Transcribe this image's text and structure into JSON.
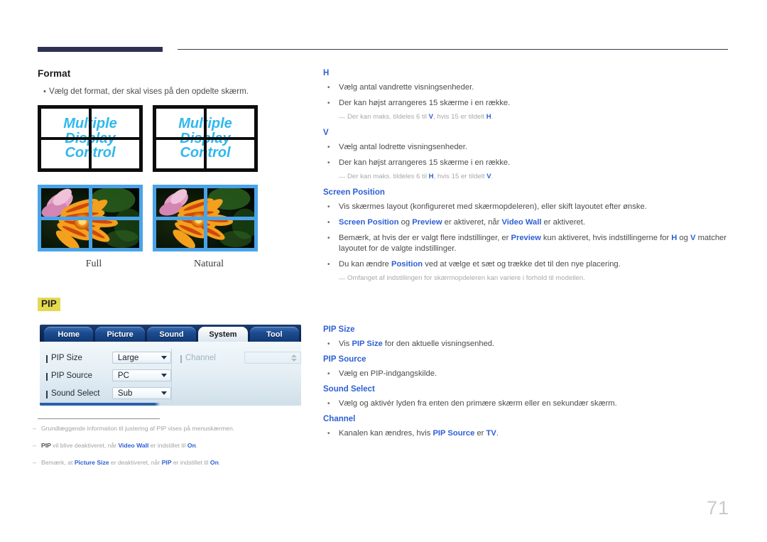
{
  "page": {
    "number": "71"
  },
  "left": {
    "format": {
      "title": "Format",
      "bullet": "Vælg det format, der skal vises på den opdelte skærm."
    },
    "wall_text": {
      "line1": "Multiple",
      "line2": "Display",
      "line3": "Control"
    },
    "captions": {
      "full": "Full",
      "natural": "Natural"
    },
    "pip_badge": "PIP",
    "osd": {
      "tabs": [
        {
          "label": "Home",
          "active": false
        },
        {
          "label": "Picture",
          "active": false
        },
        {
          "label": "Sound",
          "active": false
        },
        {
          "label": "System",
          "active": true
        },
        {
          "label": "Tool",
          "active": false
        }
      ],
      "rows": [
        {
          "label": "PIP Size",
          "value": "Large"
        },
        {
          "label": "PIP Source",
          "value": "PC"
        },
        {
          "label": "Sound Select",
          "value": "Sub"
        }
      ],
      "channel": {
        "label": "Channel",
        "value": ""
      }
    },
    "footnotes": [
      {
        "dash": "–",
        "parts": [
          {
            "t": "Grundlæggende information til justering af  PIP vises på menuskærmen.",
            "s": "plain"
          }
        ]
      },
      {
        "dash": "–",
        "parts": [
          {
            "t": "PIP",
            "s": "bold"
          },
          {
            "t": " vil blive deaktiveret, når ",
            "s": "plain"
          },
          {
            "t": "Video Wall",
            "s": "link"
          },
          {
            "t": " er indstillet til ",
            "s": "plain"
          },
          {
            "t": "On",
            "s": "link"
          },
          {
            "t": ".",
            "s": "plain"
          }
        ]
      },
      {
        "dash": "–",
        "parts": [
          {
            "t": "Bemærk, at ",
            "s": "plain"
          },
          {
            "t": "Picture Size",
            "s": "link"
          },
          {
            "t": " er deaktiveret, når ",
            "s": "plain"
          },
          {
            "t": "PIP",
            "s": "link"
          },
          {
            "t": " er indstillet til ",
            "s": "plain"
          },
          {
            "t": "On",
            "s": "link"
          },
          {
            "t": ".",
            "s": "plain"
          }
        ]
      }
    ]
  },
  "right": {
    "sections": [
      {
        "title": "H",
        "bullets": [
          {
            "parts": [
              {
                "t": "Vælg antal vandrette visningsenheder.",
                "s": "plain"
              }
            ]
          },
          {
            "parts": [
              {
                "t": "Der kan højst arrangeres 15 skærme i en række.",
                "s": "plain"
              }
            ]
          }
        ],
        "notes": [
          {
            "dash": "—",
            "parts": [
              {
                "t": "Der kan maks. tildeles 6 til ",
                "s": "plain"
              },
              {
                "t": "V",
                "s": "link"
              },
              {
                "t": ", hvis 15 er tildelt ",
                "s": "plain"
              },
              {
                "t": "H",
                "s": "link"
              },
              {
                "t": ".",
                "s": "plain"
              }
            ]
          }
        ]
      },
      {
        "title": "V",
        "bullets": [
          {
            "parts": [
              {
                "t": "Vælg antal lodrette visningsenheder.",
                "s": "plain"
              }
            ]
          },
          {
            "parts": [
              {
                "t": "Der kan højst arrangeres 15 skærme i en række.",
                "s": "plain"
              }
            ]
          }
        ],
        "notes": [
          {
            "dash": "—",
            "parts": [
              {
                "t": "Der kan maks. tildeles 6 til ",
                "s": "plain"
              },
              {
                "t": "H",
                "s": "link"
              },
              {
                "t": ", hvis 15 er tildelt ",
                "s": "plain"
              },
              {
                "t": "V",
                "s": "link"
              },
              {
                "t": ".",
                "s": "plain"
              }
            ]
          }
        ]
      },
      {
        "title": "Screen Position",
        "bullets": [
          {
            "parts": [
              {
                "t": "Vis skærmes layout (konfigureret med skærmopdeleren), eller skift layoutet efter ønske.",
                "s": "plain"
              }
            ]
          },
          {
            "parts": [
              {
                "t": "Screen Position",
                "s": "link"
              },
              {
                "t": " og ",
                "s": "plain"
              },
              {
                "t": "Preview",
                "s": "link"
              },
              {
                "t": " er aktiveret, når ",
                "s": "plain"
              },
              {
                "t": "Video Wall",
                "s": "link"
              },
              {
                "t": " er aktiveret.",
                "s": "plain"
              }
            ]
          },
          {
            "parts": [
              {
                "t": "Bemærk, at hvis der er valgt flere indstillinger, er ",
                "s": "plain"
              },
              {
                "t": "Preview",
                "s": "link"
              },
              {
                "t": " kun aktiveret, hvis indstillingerne for ",
                "s": "plain"
              },
              {
                "t": "H",
                "s": "link"
              },
              {
                "t": " og ",
                "s": "plain"
              },
              {
                "t": "V",
                "s": "link"
              },
              {
                "t": " matcher layoutet for de valgte indstillinger.",
                "s": "plain"
              }
            ]
          },
          {
            "parts": [
              {
                "t": "Du kan ændre ",
                "s": "plain"
              },
              {
                "t": "Position",
                "s": "link"
              },
              {
                "t": " ved at vælge et sæt og trække det til den nye placering.",
                "s": "plain"
              }
            ]
          }
        ],
        "notes": [
          {
            "dash": "—",
            "parts": [
              {
                "t": "Omfanget af indstillingen for skærmopdeleren kan variere i forhold til modellen.",
                "s": "plain"
              }
            ]
          }
        ]
      }
    ],
    "pip_sections": [
      {
        "title": "PIP Size",
        "bullets": [
          {
            "parts": [
              {
                "t": "Vis ",
                "s": "plain"
              },
              {
                "t": "PIP Size",
                "s": "link"
              },
              {
                "t": " for den aktuelle visningsenhed.",
                "s": "plain"
              }
            ]
          }
        ]
      },
      {
        "title": "PIP Source",
        "bullets": [
          {
            "parts": [
              {
                "t": "Vælg en PIP-indgangskilde.",
                "s": "plain"
              }
            ]
          }
        ]
      },
      {
        "title": "Sound Select",
        "bullets": [
          {
            "parts": [
              {
                "t": "Vælg og aktivér lyden fra enten den primære skærm eller en sekundær skærm.",
                "s": "plain"
              }
            ]
          }
        ]
      },
      {
        "title": "Channel",
        "bullets": [
          {
            "parts": [
              {
                "t": "Kanalen kan ændres, hvis ",
                "s": "plain"
              },
              {
                "t": "PIP Source",
                "s": "link"
              },
              {
                "t": " er ",
                "s": "plain"
              },
              {
                "t": "TV",
                "s": "link"
              },
              {
                "t": ".",
                "s": "plain"
              }
            ]
          }
        ]
      }
    ]
  },
  "bullet_glyph": "•",
  "colors": {
    "link_blue": "#2d5fd4",
    "header_bar": "#2e3152",
    "wall_text_cyan": "#2fb8ee",
    "badge_yellow": "#e4da4f",
    "page_number_gray": "#c9c9c9"
  }
}
